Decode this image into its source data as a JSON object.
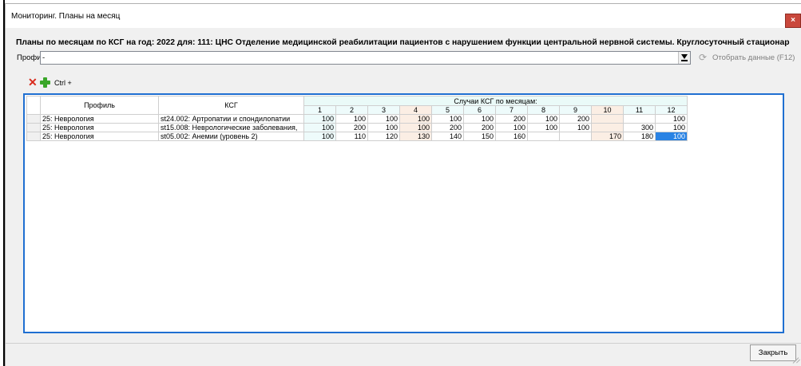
{
  "window": {
    "title": "Мониторинг. Планы на месяц",
    "close_glyph": "×"
  },
  "heading": "Планы по месяцам по КСГ на год: 2022 для: 111: ЦНС Отделение медицинской реабилитации пациентов с нарушением функции центральной нервной системы. Круглосуточный стационар",
  "filter": {
    "profile_label": "Профиль",
    "profile_value": "-",
    "show_button": "Отобрать данные (F12)"
  },
  "toolbar": {
    "ctrl_label": "Ctrl +"
  },
  "table": {
    "col_profile": "Профиль",
    "col_ksg": "КСГ",
    "group_label": "Случаи КСГ по месяцам:",
    "months": [
      "1",
      "2",
      "3",
      "4",
      "5",
      "6",
      "7",
      "8",
      "9",
      "10",
      "11",
      "12"
    ],
    "rows": [
      {
        "profile": "25: Неврология",
        "ksg": "st24.002: Артропатии и спондилопатии",
        "values": [
          "100",
          "100",
          "100",
          "100",
          "100",
          "100",
          "200",
          "100",
          "200",
          "",
          "",
          "100"
        ]
      },
      {
        "profile": "25: Неврология",
        "ksg": "st15.008: Неврологические заболевания,",
        "values": [
          "100",
          "200",
          "100",
          "100",
          "200",
          "200",
          "100",
          "100",
          "100",
          "",
          "300",
          "100"
        ]
      },
      {
        "profile": "25: Неврология",
        "ksg": "st05.002: Анемии (уровень 2)",
        "values": [
          "100",
          "110",
          "120",
          "130",
          "140",
          "150",
          "160",
          "",
          "",
          "170",
          "180",
          "100"
        ]
      }
    ]
  },
  "footer": {
    "close_button": "Закрыть"
  },
  "colors": {
    "accent": "#1f6fd1",
    "highlight_cell": "#2a83e4",
    "month_col_alt": "#fbeee4",
    "month_col": "#eefbfb",
    "delete_icon": "#d92a1c",
    "add_icon": "#3aa629"
  }
}
